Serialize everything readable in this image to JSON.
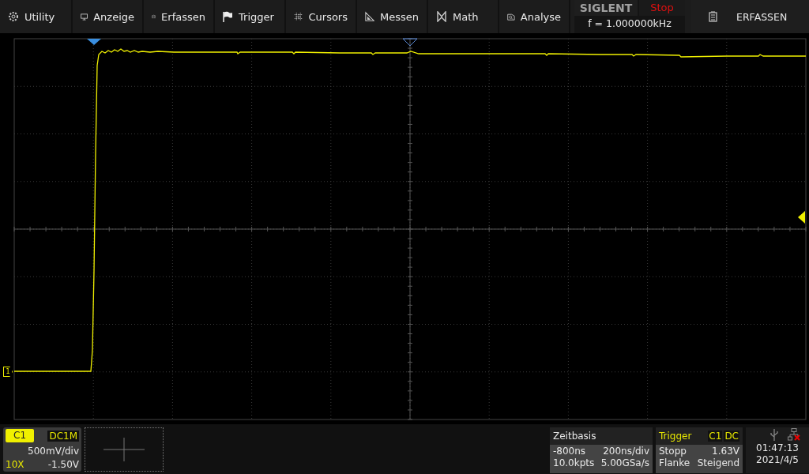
{
  "menu": [
    {
      "label": "Utility"
    },
    {
      "label": "Anzeige"
    },
    {
      "label": "Erfassen"
    },
    {
      "label": "Trigger"
    },
    {
      "label": "Cursors"
    },
    {
      "label": "Messen"
    },
    {
      "label": "Math"
    },
    {
      "label": "Analyse"
    }
  ],
  "brand": {
    "logo": "SIGLENT",
    "run_state": "Stop",
    "frequency": "f = 1.000000kHz"
  },
  "capture_button": {
    "label": "ERFASSEN"
  },
  "channel": {
    "name": "C1",
    "coupling": "DC1M",
    "scale": "500mV/div",
    "probe": "10X",
    "offset": "-1.50V"
  },
  "channel_marker": "1",
  "timebase": {
    "title": "Zeitbasis",
    "delay": "-800ns",
    "scale": "200ns/div",
    "memory": "10.0kpts",
    "sample_rate": "5.00GSa/s"
  },
  "trigger": {
    "title": "Trigger",
    "source": "C1",
    "coupling": "DC",
    "mode": "Stopp",
    "level": "1.63V",
    "type": "Flanke",
    "slope": "Steigend"
  },
  "status": {
    "time": "01:47:13",
    "date": "2021/4/5"
  }
}
